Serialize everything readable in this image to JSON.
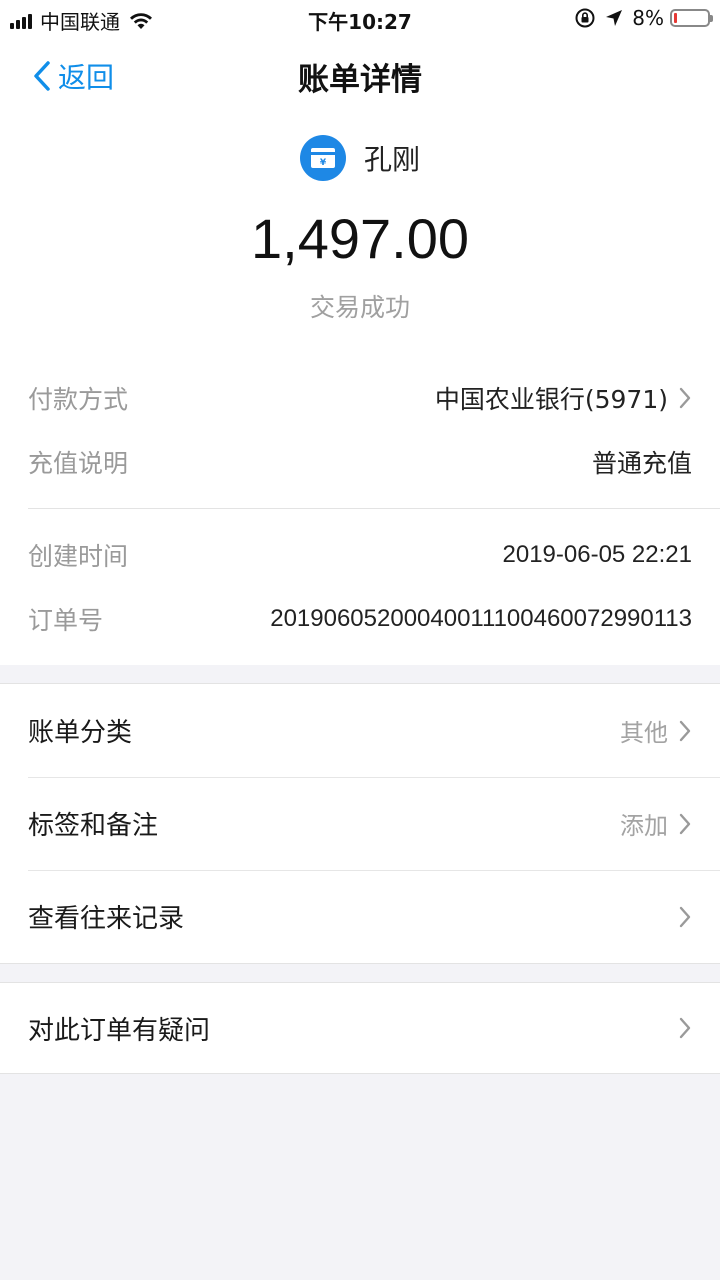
{
  "status_bar": {
    "carrier": "中国联通",
    "time": "下午10:27",
    "battery_pct": "8%",
    "battery_level": 0.08,
    "battery_color": "#e53935"
  },
  "nav": {
    "back_label": "返回",
    "title": "账单详情"
  },
  "header": {
    "payee_name": "孔刚",
    "amount": "1,497.00",
    "status": "交易成功",
    "logo_icon": "bank-card-yuan-icon",
    "logo_color": "#1e88e5"
  },
  "details": {
    "payment_method_label": "付款方式",
    "payment_method_value": "中国农业银行(5971)",
    "recharge_label": "充值说明",
    "recharge_value": "普通充值",
    "created_label": "创建时间",
    "created_value": "2019-06-05 22:21",
    "order_label": "订单号",
    "order_value": "20190605200040011100460072990113"
  },
  "options": {
    "category_label": "账单分类",
    "category_value": "其他",
    "tags_label": "标签和备注",
    "tags_value": "添加",
    "history_label": "查看往来记录"
  },
  "faq": {
    "question_label": "对此订单有疑问"
  },
  "colors": {
    "accent": "#108ee9",
    "background": "#f3f3f7"
  }
}
